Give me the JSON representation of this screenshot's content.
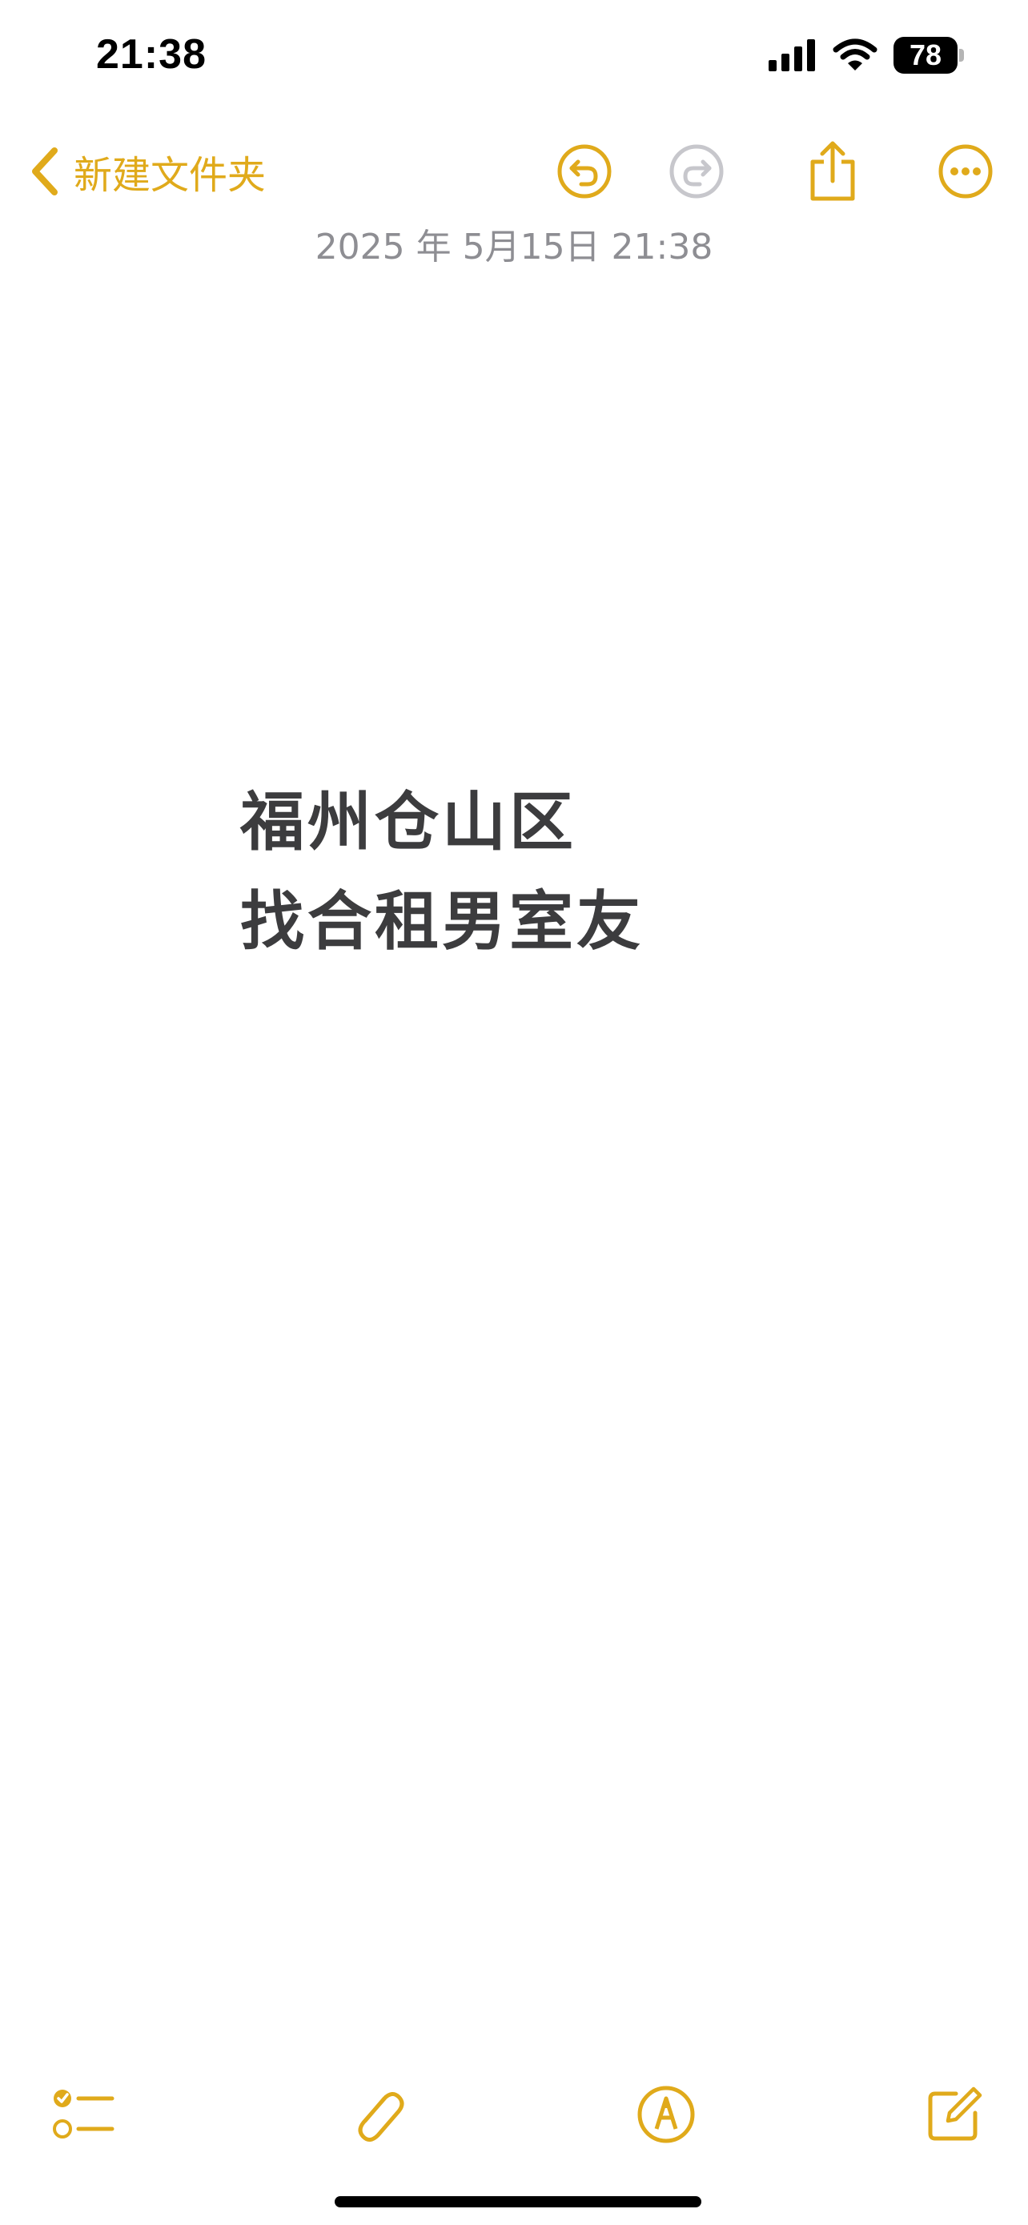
{
  "status_bar": {
    "time": "21:38",
    "battery": "78",
    "icons": [
      "signal-icon",
      "wifi-icon",
      "battery-icon"
    ]
  },
  "nav": {
    "back_label": "新建文件夹",
    "icons": [
      "chevron-left-icon",
      "undo-icon",
      "redo-icon",
      "share-icon",
      "more-icon"
    ]
  },
  "note": {
    "date": "2025 年 5月15日 21:38",
    "lines": [
      "福州仓山区",
      "找合租男室友"
    ]
  },
  "toolbar": {
    "icons": [
      "checklist-icon",
      "paperclip-icon",
      "markup-icon",
      "compose-icon"
    ]
  },
  "colors": {
    "accent": "#e0aa1b",
    "disabled": "#c7c7cc",
    "text": "#3c3c3e",
    "date_text": "#8e8e93"
  }
}
